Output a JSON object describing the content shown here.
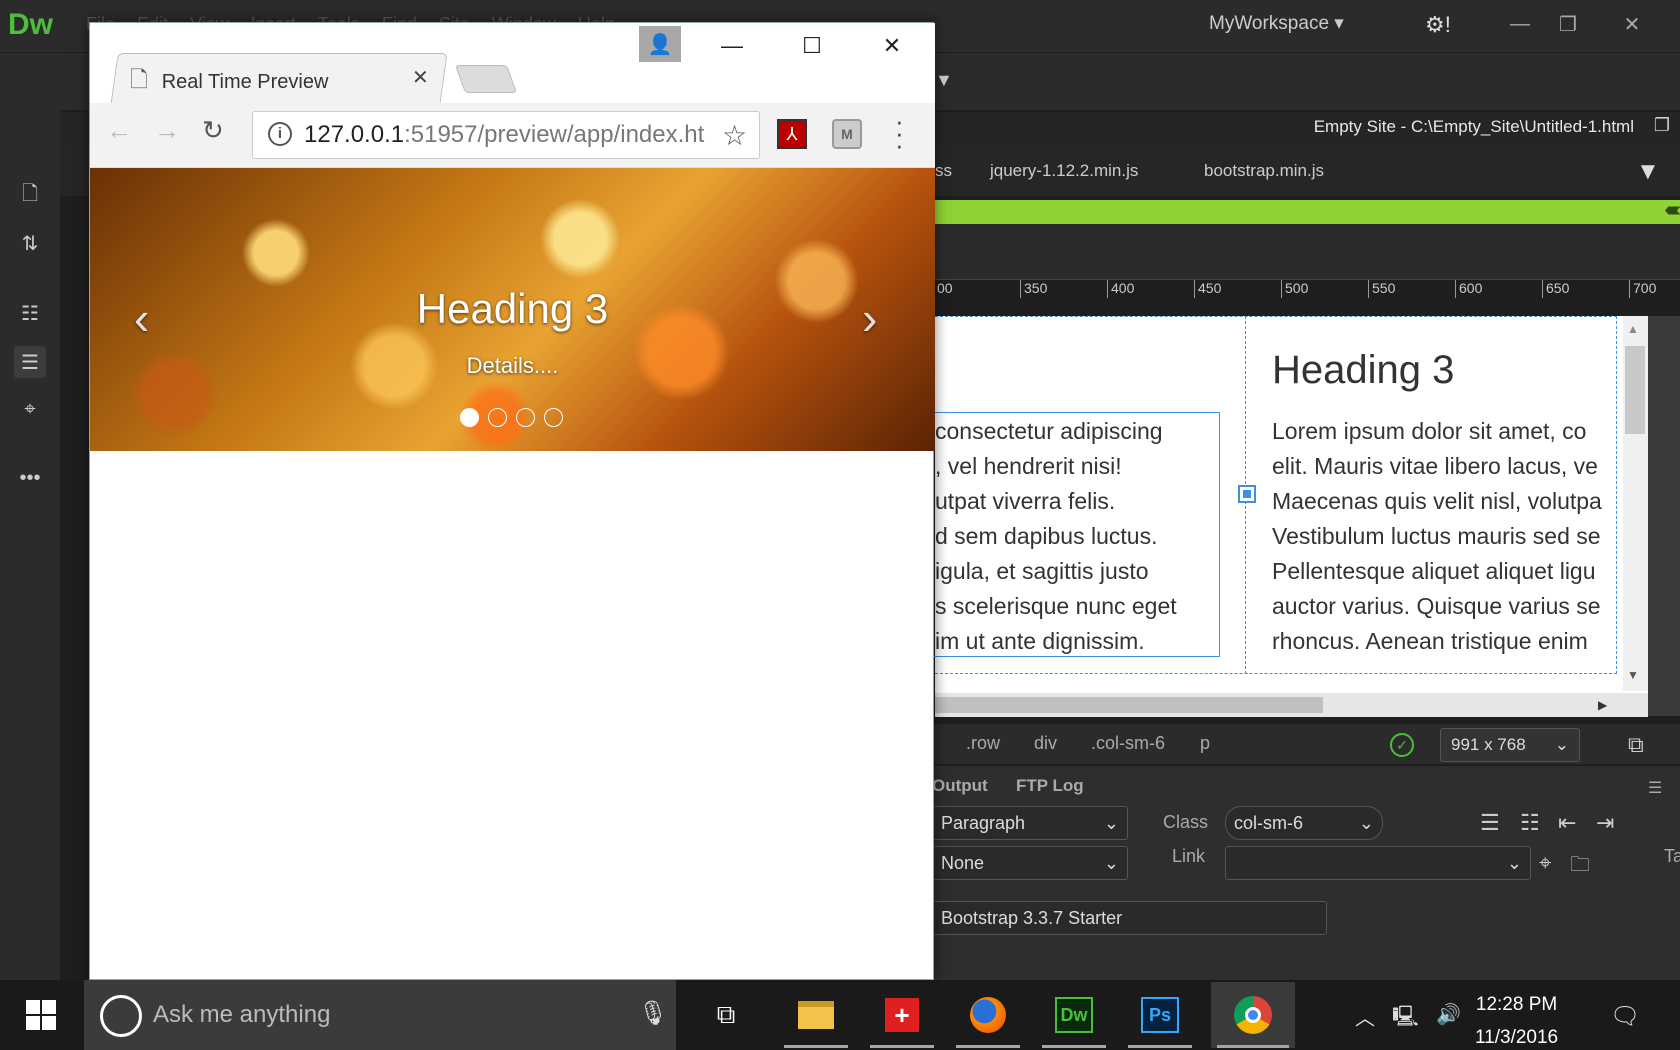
{
  "dreamweaver": {
    "logo": "Dw",
    "menus": [
      "File",
      "Edit",
      "View",
      "Insert",
      "Tools",
      "Find",
      "Site",
      "Window",
      "Help"
    ],
    "workspace": "MyWorkspace",
    "doc_title": "Empty Site - C:\\Empty_Site\\Untitled-1.html",
    "related_files": [
      "ss",
      "jquery-1.12.2.min.js",
      "bootstrap.min.js"
    ],
    "ruler_ticks": [
      "00",
      "350",
      "400",
      "450",
      "500",
      "550",
      "600",
      "650",
      "700"
    ],
    "design": {
      "heading": "Heading 3",
      "left_column_lines": [
        "consectetur adipiscing",
        ", vel hendrerit nisi!",
        "utpat viverra felis.",
        "d sem dapibus luctus.",
        "igula, et sagittis justo",
        "s scelerisque nunc eget",
        "im ut ante dignissim."
      ],
      "right_column_lines": [
        "Lorem ipsum dolor sit amet, co",
        "elit. Mauris vitae libero lacus, ve",
        "Maecenas quis velit nisl, volutpa",
        "Vestibulum luctus mauris sed se",
        "Pellentesque aliquet aliquet ligu",
        "auctor varius. Quisque varius se",
        "rhoncus. Aenean tristique enim"
      ]
    },
    "tag_selector": [
      ".row",
      "div",
      ".col-sm-6",
      "p"
    ],
    "screen_size": "991 x 768",
    "panel_tabs": [
      "Output",
      "FTP Log"
    ],
    "properties": {
      "format": "Paragraph",
      "heading_none": "None",
      "class_label": "Class",
      "class_value": "col-sm-6",
      "link_label": "Link",
      "link_value": "",
      "template": "Bootstrap 3.3.7 Starter",
      "edge_label": "Ta"
    }
  },
  "chrome": {
    "tab_title": "Real Time Preview",
    "url_host": "127.0.0.1",
    "url_path": ":51957/preview/app/index.ht",
    "carousel": {
      "heading": "Heading 3",
      "details": "Details....",
      "slide_count": 4,
      "active_slide": 1
    }
  },
  "taskbar": {
    "search_placeholder": "Ask me anything",
    "apps": [
      "task-view",
      "file-explorer",
      "app-red-cross",
      "firefox",
      "dreamweaver",
      "photoshop",
      "chrome"
    ],
    "dw_label": "Dw",
    "ps_label": "Ps",
    "time": "12:28 PM",
    "date": "11/3/2016"
  }
}
